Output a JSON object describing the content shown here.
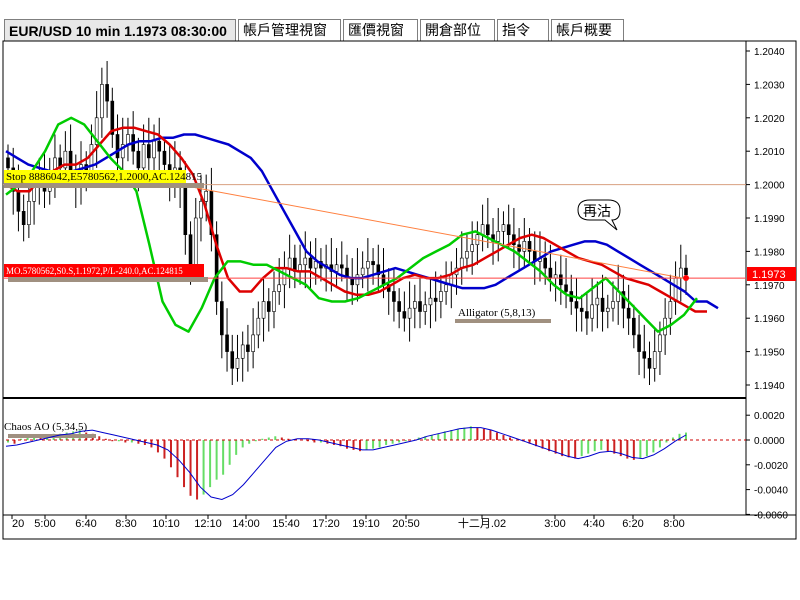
{
  "tabs": [
    {
      "label": "EUR/USD 10 min 1.1973 08:30:00",
      "active": true
    },
    {
      "label": "帳戶管理視窗",
      "active": false
    },
    {
      "label": "匯價視窗",
      "active": false
    },
    {
      "label": "開倉部位",
      "active": false
    },
    {
      "label": "指令",
      "active": false
    },
    {
      "label": "帳戶概要",
      "active": false
    }
  ],
  "annotations": {
    "stop_label": "Stop 8886042,E5780562,1.2000,AC.124815",
    "mo_label": "MO.5780562,S0.S,1.1972,P/L-240.0,AC.124815",
    "price_tag": "1.1973",
    "alligator_label": "Alligator (5,8,13)",
    "ao_label": "Chaos AO (5,34,5)",
    "callout": "再沽"
  },
  "colors": {
    "jaw": "#0000cc",
    "teeth": "#dd0000",
    "lips": "#00cc00",
    "trendline": "#ff8040",
    "stop_line": "#d8a080",
    "mo_line": "#ff4040",
    "price_tag_bg": "#ff0000",
    "stop_label_bg": "#ffff00",
    "mo_label_bg": "#ff0000",
    "ao_up": "#66dd66",
    "ao_down": "#cc2222"
  },
  "chart_data": [
    {
      "type": "candlestick",
      "title": "EUR/USD 10 min 1.1973 08:30:00",
      "x_tick_labels": [
        "20",
        "5:00",
        "6:40",
        "8:30",
        "10:10",
        "12:10",
        "14:00",
        "15:40",
        "17:20",
        "19:10",
        "20:50",
        "十二月.02",
        "3:00",
        "4:40",
        "6:20",
        "8:00"
      ],
      "y_tick_labels": [
        "1.2040",
        "1.2030",
        "1.2020",
        "1.2010",
        "1.2000",
        "1.1990",
        "1.1980",
        "1.1970",
        "1.1960",
        "1.1950",
        "1.1940"
      ],
      "ylim": [
        1.1935,
        1.2045
      ],
      "last_price": 1.1973,
      "horizontal_lines": [
        {
          "name": "Stop",
          "y": 1.2
        },
        {
          "name": "MO",
          "y": 1.1972
        }
      ],
      "close": [
        1.2005,
        1.1998,
        1.1992,
        1.1988,
        1.1995,
        1.2,
        1.2002,
        1.1998,
        1.2003,
        1.2008,
        1.2005,
        1.201,
        1.2004,
        1.2,
        1.2006,
        1.2003,
        1.2012,
        1.202,
        1.203,
        1.2025,
        1.2015,
        1.2008,
        1.2012,
        1.2015,
        1.201,
        1.2005,
        1.2012,
        1.2008,
        1.2013,
        1.201,
        1.2006,
        1.2,
        1.2005,
        1.2,
        1.1985,
        1.1975,
        1.199,
        1.1995,
        1.1998,
        1.1985,
        1.1965,
        1.1955,
        1.195,
        1.1945,
        1.1948,
        1.1952,
        1.195,
        1.1955,
        1.196,
        1.1965,
        1.1962,
        1.1968,
        1.197,
        1.1975,
        1.1978,
        1.1974,
        1.1976,
        1.1978,
        1.1975,
        1.1977,
        1.1975,
        1.1976,
        1.1974,
        1.1976,
        1.1975,
        1.1972,
        1.197,
        1.1973,
        1.1975,
        1.1977,
        1.1976,
        1.1973,
        1.197,
        1.1968,
        1.1965,
        1.1962,
        1.196,
        1.1963,
        1.1965,
        1.1962,
        1.1964,
        1.1966,
        1.1965,
        1.1968,
        1.197,
        1.1973,
        1.1975,
        1.1978,
        1.198,
        1.1982,
        1.1985,
        1.1988,
        1.1985,
        1.1983,
        1.1986,
        1.1988,
        1.1985,
        1.1982,
        1.198,
        1.1983,
        1.198,
        1.1977,
        1.1978,
        1.1975,
        1.1972,
        1.1973,
        1.197,
        1.1968,
        1.1965,
        1.1963,
        1.1962,
        1.196,
        1.1964,
        1.1966,
        1.1962,
        1.1963,
        1.1965,
        1.1968,
        1.1963,
        1.196,
        1.1955,
        1.195,
        1.1948,
        1.1945,
        1.195,
        1.1955,
        1.196,
        1.1965,
        1.1972,
        1.1975,
        1.1973
      ],
      "series": [
        {
          "name": "Jaw",
          "values": [
            1.201,
            1.2008,
            1.2006,
            1.2005,
            1.2004,
            1.2004,
            1.2004,
            1.2005,
            1.2006,
            1.2008,
            1.201,
            1.2012,
            1.2013,
            1.2013,
            1.2014,
            1.2014,
            1.2015,
            1.2015,
            1.2014,
            1.2013,
            1.2012,
            1.201,
            1.2008,
            1.2004,
            1.1998,
            1.1992,
            1.1986,
            1.198,
            1.1977,
            1.1975,
            1.1973,
            1.1972,
            1.1972,
            1.1973,
            1.1974,
            1.1975,
            1.1974,
            1.1973,
            1.1972,
            1.1971,
            1.197,
            1.1969,
            1.1969,
            1.1969,
            1.197,
            1.1972,
            1.1974,
            1.1976,
            1.1978,
            1.198,
            1.1981,
            1.1982,
            1.1983,
            1.1983,
            1.1982,
            1.198,
            1.1978,
            1.1976,
            1.1974,
            1.1972,
            1.197,
            1.1968,
            1.1965,
            1.1965,
            1.1963
          ]
        },
        {
          "name": "Teeth",
          "values": [
            1.2,
            1.1998,
            1.1998,
            1.2002,
            1.2004,
            1.2006,
            1.2006,
            1.2008,
            1.2012,
            1.2016,
            1.2017,
            1.2017,
            1.2016,
            1.2015,
            1.2012,
            1.2008,
            1.2003,
            1.1994,
            1.1982,
            1.1972,
            1.1968,
            1.1968,
            1.1972,
            1.1975,
            1.1975,
            1.1974,
            1.1974,
            1.1972,
            1.197,
            1.1968,
            1.1967,
            1.1967,
            1.1968,
            1.197,
            1.1972,
            1.1973,
            1.1972,
            1.1972,
            1.1973,
            1.1975,
            1.1976,
            1.1978,
            1.198,
            1.1982,
            1.1984,
            1.1985,
            1.1984,
            1.1982,
            1.198,
            1.1978,
            1.1977,
            1.1976,
            1.1974,
            1.1972,
            1.1971,
            1.197,
            1.1968,
            1.1966,
            1.1964,
            1.1962,
            1.1962
          ]
        },
        {
          "name": "Lips",
          "values": [
            1.1997,
            1.2,
            1.2004,
            1.201,
            1.2018,
            1.202,
            1.2018,
            1.2013,
            1.2008,
            1.2004,
            1.1998,
            1.1982,
            1.1965,
            1.1958,
            1.1956,
            1.1963,
            1.1972,
            1.1977,
            1.1977,
            1.1976,
            1.1976,
            1.1974,
            1.1972,
            1.197,
            1.1966,
            1.1965,
            1.1965,
            1.1966,
            1.1968,
            1.197,
            1.1972,
            1.1975,
            1.1978,
            1.198,
            1.1982,
            1.1985,
            1.1986,
            1.1984,
            1.1982,
            1.198,
            1.1977,
            1.1974,
            1.197,
            1.1967,
            1.1966,
            1.1969,
            1.1972,
            1.1968,
            1.1964,
            1.196,
            1.1956,
            1.1958,
            1.1961,
            1.1966
          ]
        }
      ]
    },
    {
      "type": "bar",
      "title": "Chaos AO (5,34,5)",
      "y_tick_labels": [
        "0.0020",
        "0.0000",
        "-0.0020",
        "-0.0040",
        "-0.0060"
      ],
      "ylim": [
        -0.0058,
        0.003
      ],
      "values": [
        -0.0002,
        -0.0003,
        0.0001,
        0.0002,
        0.0003,
        0.0002,
        0.0004,
        0.0005,
        0.0005,
        0.0006,
        0.0007,
        0.0008,
        0.0006,
        0.0005,
        0.0003,
        0.0001,
        -0.0001,
        -0.0001,
        -0.0002,
        -0.0002,
        -0.0003,
        -0.0004,
        -0.0006,
        -0.001,
        -0.0015,
        -0.0022,
        -0.003,
        -0.0038,
        -0.0045,
        -0.0048,
        -0.0044,
        -0.0038,
        -0.0032,
        -0.0028,
        -0.002,
        -0.0012,
        -0.0006,
        -0.0003,
        -0.0001,
        0.0001,
        0.0002,
        0.0003,
        0.0002,
        0.0001,
        0.0,
        0.0,
        -0.0001,
        -0.0002,
        -0.0002,
        -0.0003,
        -0.0004,
        -0.0005,
        -0.0007,
        -0.0008,
        -0.0009,
        -0.0008,
        -0.0007,
        -0.0006,
        -0.0004,
        -0.0003,
        -0.0002,
        -0.0001,
        0.0,
        0.0002,
        0.0003,
        0.0004,
        0.0005,
        0.0007,
        0.0008,
        0.0009,
        0.001,
        0.0011,
        0.001,
        0.0009,
        0.0008,
        0.0006,
        0.0004,
        0.0002,
        0.0,
        -0.0001,
        -0.0003,
        -0.0005,
        -0.0007,
        -0.0009,
        -0.0011,
        -0.0013,
        -0.0014,
        -0.0015,
        -0.0013,
        -0.0011,
        -0.0009,
        -0.0008,
        -0.0009,
        -0.0011,
        -0.0013,
        -0.0015,
        -0.0016,
        -0.0015,
        -0.0013,
        -0.001,
        -0.0006,
        -0.0002,
        0.0002,
        0.0005,
        0.0006
      ],
      "signal_line": [
        -0.0005,
        -0.0004,
        -0.0002,
        0.0,
        0.0002,
        0.0004,
        0.0005,
        0.0007,
        0.0008,
        0.0006,
        0.0004,
        0.0002,
        0.0,
        -0.0002,
        -0.0004,
        -0.0008,
        -0.0016,
        -0.0026,
        -0.0038,
        -0.0046,
        -0.0048,
        -0.0044,
        -0.0036,
        -0.0026,
        -0.0016,
        -0.0006,
        -0.0001,
        0.0001,
        0.0001,
        0.0,
        -0.0002,
        -0.0004,
        -0.0006,
        -0.0008,
        -0.0008,
        -0.0006,
        -0.0004,
        -0.0002,
        0.0,
        0.0003,
        0.0005,
        0.0007,
        0.0009,
        0.001,
        0.001,
        0.0008,
        0.0005,
        0.0002,
        -0.0001,
        -0.0004,
        -0.0007,
        -0.001,
        -0.0013,
        -0.0015,
        -0.0013,
        -0.001,
        -0.0009,
        -0.0011,
        -0.0014,
        -0.0015,
        -0.0012,
        -0.0007,
        -0.0001,
        0.0004
      ],
      "zero_line": 0.0
    }
  ]
}
